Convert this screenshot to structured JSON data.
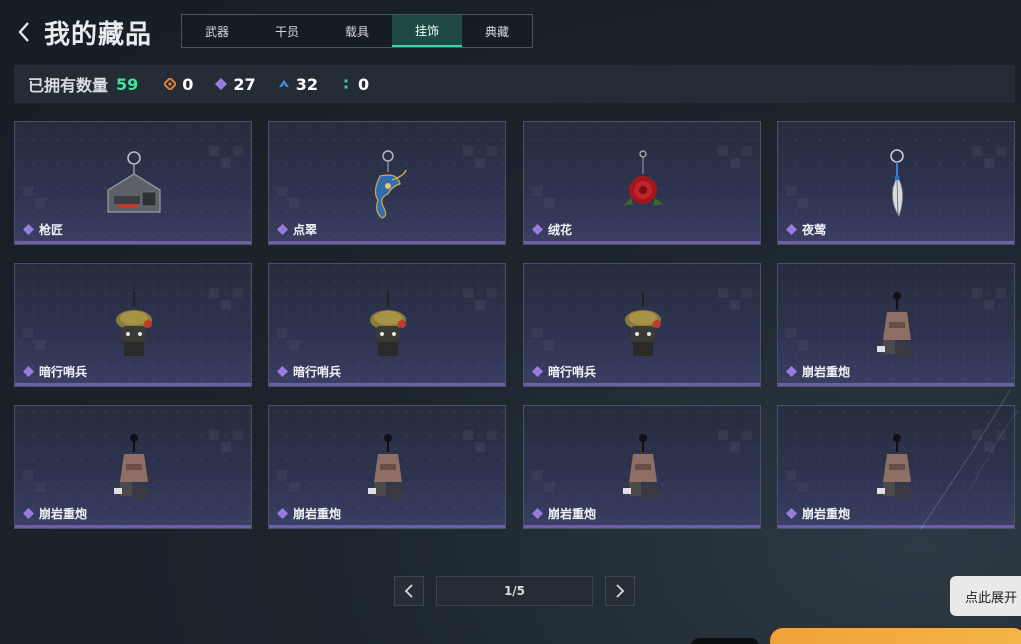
{
  "header": {
    "title": "我的藏品",
    "tabs": [
      {
        "label": "武器",
        "active": false
      },
      {
        "label": "干员",
        "active": false
      },
      {
        "label": "载具",
        "active": false
      },
      {
        "label": "挂饰",
        "active": true
      },
      {
        "label": "典藏",
        "active": false
      }
    ]
  },
  "stats": {
    "owned_label": "已拥有数量",
    "owned_total": "59",
    "counts": [
      {
        "icon": "orange-diamond-icon",
        "color": "#e0823a",
        "value": "0"
      },
      {
        "icon": "purple-diamond-icon",
        "color": "#9b7fe0",
        "value": "27"
      },
      {
        "icon": "blue-chevron-icon",
        "color": "#3f8fe0",
        "value": "32"
      },
      {
        "icon": "green-dots-icon",
        "color": "#3fc7a0",
        "value": "0"
      }
    ]
  },
  "items": [
    {
      "name": "枪匠",
      "art": "tag"
    },
    {
      "name": "点翠",
      "art": "phoenix"
    },
    {
      "name": "绒花",
      "art": "rose"
    },
    {
      "name": "夜莺",
      "art": "feather"
    },
    {
      "name": "暗行哨兵",
      "art": "sentry"
    },
    {
      "name": "暗行哨兵",
      "art": "sentry"
    },
    {
      "name": "暗行哨兵",
      "art": "sentry"
    },
    {
      "name": "崩岩重炮",
      "art": "cannon"
    },
    {
      "name": "崩岩重炮",
      "art": "cannon"
    },
    {
      "name": "崩岩重炮",
      "art": "cannon"
    },
    {
      "name": "崩岩重炮",
      "art": "cannon"
    },
    {
      "name": "崩岩重炮",
      "art": "cannon"
    }
  ],
  "rarity_color": "#9b7fe0",
  "pagination": {
    "indicator": "1/5"
  },
  "expand_hint": "点此展开"
}
